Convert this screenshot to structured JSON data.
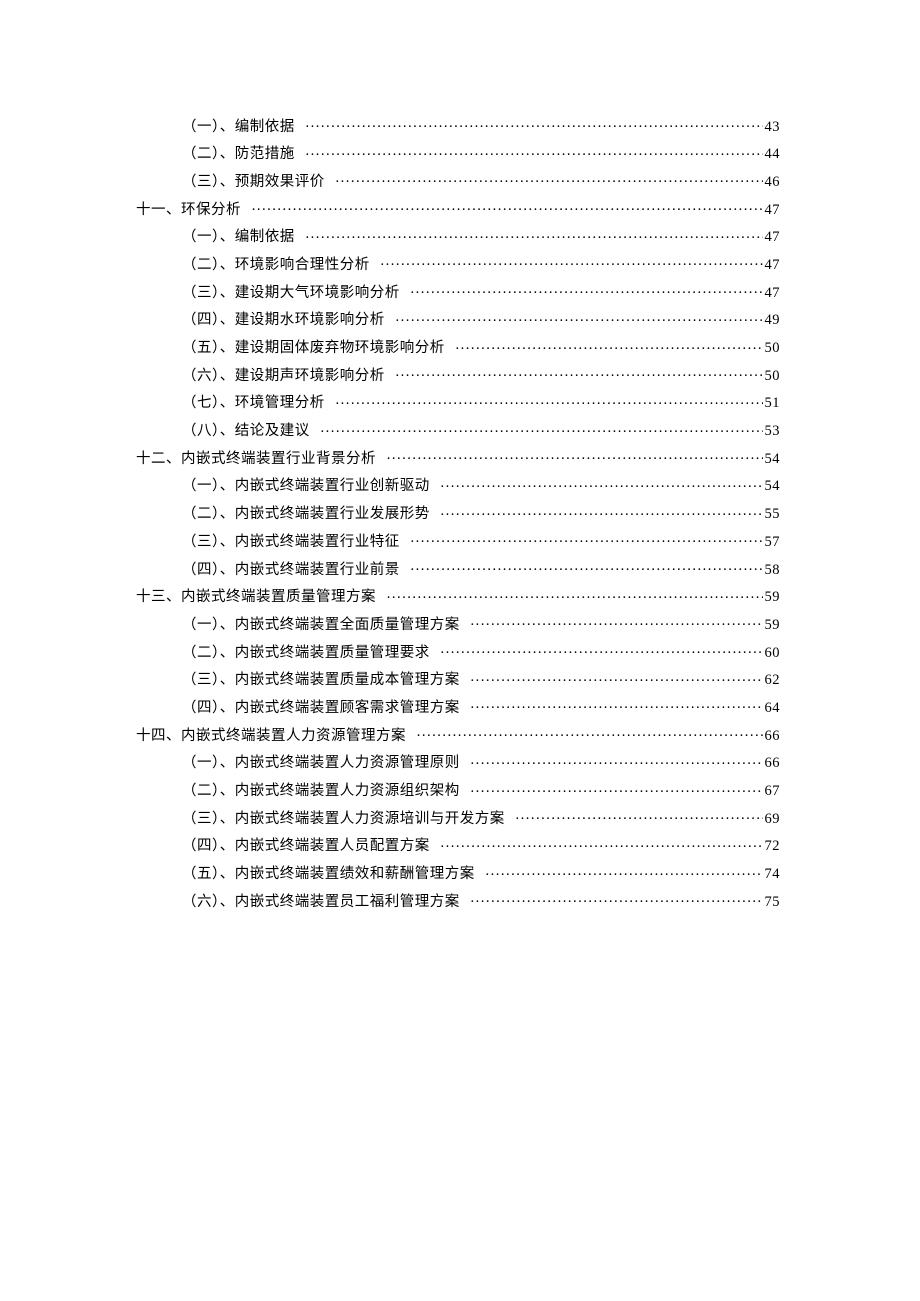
{
  "toc": [
    {
      "type": "sub",
      "prefix": "（一）、",
      "title": "编制依据",
      "page": "43"
    },
    {
      "type": "sub",
      "prefix": "（二）、",
      "title": "防范措施",
      "page": "44"
    },
    {
      "type": "sub",
      "prefix": "（三）、",
      "title": "预期效果评价",
      "page": "46"
    },
    {
      "type": "section",
      "prefix": "十一、",
      "title": "环保分析",
      "page": "47"
    },
    {
      "type": "sub",
      "prefix": "（一）、",
      "title": "编制依据",
      "page": "47"
    },
    {
      "type": "sub",
      "prefix": "（二）、",
      "title": "环境影响合理性分析",
      "page": "47"
    },
    {
      "type": "sub",
      "prefix": "（三）、",
      "title": "建设期大气环境影响分析",
      "page": "47"
    },
    {
      "type": "sub",
      "prefix": "（四）、",
      "title": "建设期水环境影响分析",
      "page": "49"
    },
    {
      "type": "sub",
      "prefix": "（五）、",
      "title": "建设期固体废弃物环境影响分析",
      "page": "50"
    },
    {
      "type": "sub",
      "prefix": "（六）、",
      "title": "建设期声环境影响分析",
      "page": "50"
    },
    {
      "type": "sub",
      "prefix": "（七）、",
      "title": "环境管理分析",
      "page": "51"
    },
    {
      "type": "sub",
      "prefix": "（八）、",
      "title": "结论及建议",
      "page": "53"
    },
    {
      "type": "section",
      "prefix": "十二、",
      "title": "内嵌式终端装置行业背景分析",
      "page": "54"
    },
    {
      "type": "sub",
      "prefix": "（一）、",
      "title": "内嵌式终端装置行业创新驱动",
      "page": "54"
    },
    {
      "type": "sub",
      "prefix": "（二）、",
      "title": "内嵌式终端装置行业发展形势",
      "page": "55"
    },
    {
      "type": "sub",
      "prefix": "（三）、",
      "title": "内嵌式终端装置行业特征",
      "page": "57"
    },
    {
      "type": "sub",
      "prefix": "（四）、",
      "title": "内嵌式终端装置行业前景",
      "page": "58"
    },
    {
      "type": "section",
      "prefix": "十三、",
      "title": "内嵌式终端装置质量管理方案",
      "page": "59"
    },
    {
      "type": "sub",
      "prefix": "（一）、",
      "title": "内嵌式终端装置全面质量管理方案",
      "page": "59"
    },
    {
      "type": "sub",
      "prefix": "（二）、",
      "title": "内嵌式终端装置质量管理要求",
      "page": "60"
    },
    {
      "type": "sub",
      "prefix": "（三）、",
      "title": "内嵌式终端装置质量成本管理方案",
      "page": "62"
    },
    {
      "type": "sub",
      "prefix": "（四）、",
      "title": "内嵌式终端装置顾客需求管理方案",
      "page": "64"
    },
    {
      "type": "section",
      "prefix": "十四、",
      "title": "内嵌式终端装置人力资源管理方案",
      "page": "66"
    },
    {
      "type": "sub",
      "prefix": "（一）、",
      "title": "内嵌式终端装置人力资源管理原则",
      "page": "66"
    },
    {
      "type": "sub",
      "prefix": "（二）、",
      "title": "内嵌式终端装置人力资源组织架构",
      "page": "67"
    },
    {
      "type": "sub",
      "prefix": "（三）、",
      "title": "内嵌式终端装置人力资源培训与开发方案",
      "page": "69"
    },
    {
      "type": "sub",
      "prefix": "（四）、",
      "title": "内嵌式终端装置人员配置方案",
      "page": "72"
    },
    {
      "type": "sub",
      "prefix": "（五）、",
      "title": "内嵌式终端装置绩效和薪酬管理方案",
      "page": "74"
    },
    {
      "type": "sub",
      "prefix": "（六）、",
      "title": "内嵌式终端装置员工福利管理方案",
      "page": "75"
    }
  ]
}
